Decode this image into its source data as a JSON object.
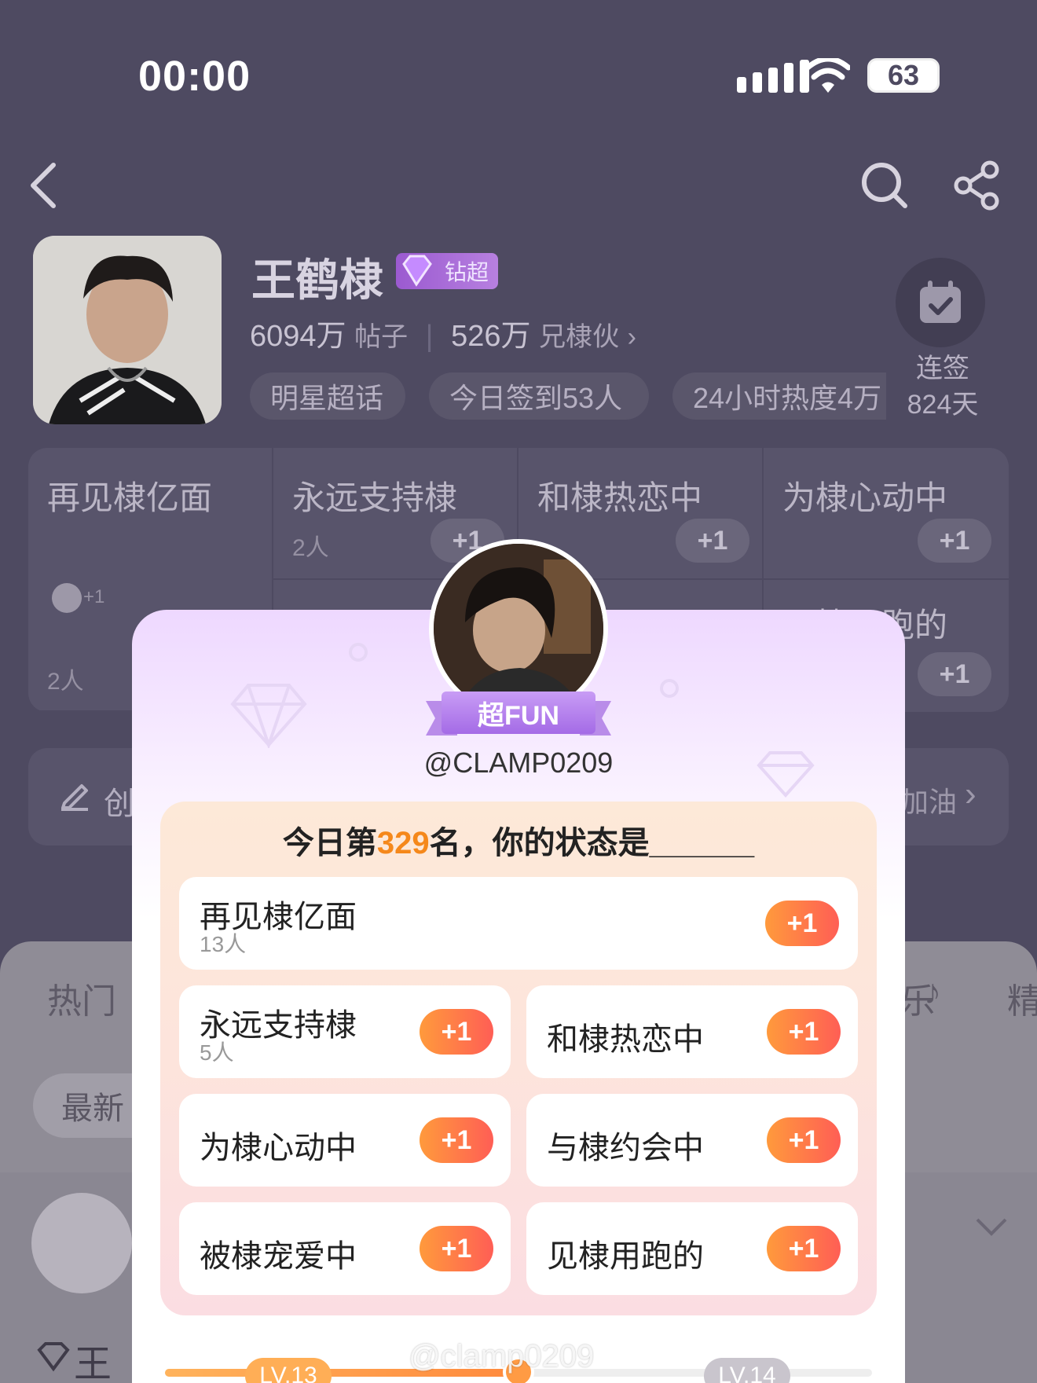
{
  "status_bar": {
    "time": "00:00",
    "battery": "63"
  },
  "topic": {
    "name": "王鹤棣",
    "badge": "钻超",
    "posts_value": "6094万",
    "posts_label": "帖子",
    "fans_value": "526万",
    "fans_label": "兄棣伙",
    "tags": [
      "明星超话",
      "今日签到53人",
      "24小时热度4万"
    ],
    "streak_label": "连签",
    "streak_days": "824天"
  },
  "bg_grid": {
    "cells": [
      {
        "title": "再见棣亿面",
        "count": "2人",
        "plus": "+1"
      },
      {
        "title": "永远支持棣",
        "count": "2人",
        "plus": "+1"
      },
      {
        "title": "和棣热恋中",
        "plus": "+1"
      },
      {
        "title": "为棣心动中",
        "plus": "+1"
      },
      {
        "title": "见棣用跑的",
        "plus": "+1"
      }
    ],
    "mini_plus": "+1"
  },
  "create_bar": {
    "label": "创",
    "right": "加油"
  },
  "bottom": {
    "tabs": [
      "热门",
      "乐",
      "精"
    ],
    "filter_pill": "最新",
    "post_name": "王"
  },
  "popup": {
    "ribbon": "超FUN",
    "username": "@CLAMP0209",
    "question_prefix": "今日第",
    "rank": "329",
    "question_suffix": "名，你的状态是______",
    "options": [
      {
        "title": "再见棣亿面",
        "count": "13人",
        "plus": "+1"
      },
      {
        "title": "永远支持棣",
        "count": "5人",
        "plus": "+1"
      },
      {
        "title": "和棣热恋中",
        "plus": "+1"
      },
      {
        "title": "为棣心动中",
        "plus": "+1"
      },
      {
        "title": "与棣约会中",
        "plus": "+1"
      },
      {
        "title": "被棣宠爱中",
        "plus": "+1"
      },
      {
        "title": "见棣用跑的",
        "plus": "+1"
      }
    ],
    "level_current": "LV.13",
    "level_next": "LV.14",
    "level_progress": 0.5
  },
  "watermark": "@clamp0209",
  "colors": {
    "overlay_bg": "#4e4a61",
    "accent_orange": "#f5881b",
    "plus_gradient": [
      "#ff9a3c",
      "#ff5e55"
    ],
    "vip_purple": "#9b5ad0"
  }
}
